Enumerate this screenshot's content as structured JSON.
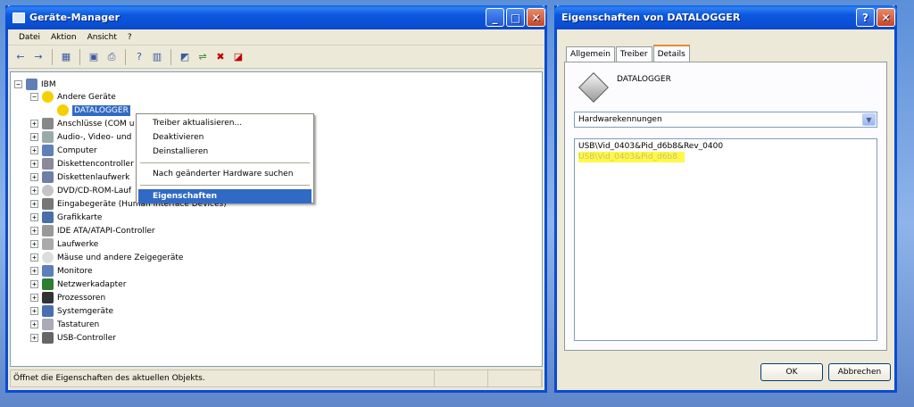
{
  "device_manager": {
    "title": "Geräte-Manager",
    "menu": [
      "Datei",
      "Aktion",
      "Ansicht",
      "?"
    ],
    "toolbar_icons": [
      "back-icon",
      "forward-icon",
      "view-icon",
      "properties-icon",
      "print-icon",
      "help-icon",
      "view2-icon",
      "scan-icon",
      "update-driver-icon",
      "disable-icon",
      "uninstall-icon"
    ],
    "tree": {
      "root": "IBM",
      "other_devices": "Andere Geräte",
      "datalogger": "DATALOGGER",
      "items": [
        "Anschlüsse (COM u",
        "Audio-, Video- und",
        "Computer",
        "Diskettencontroller",
        "Diskettenlaufwerk",
        "DVD/CD-ROM-Lauf",
        "Eingabegeräte (Human Interface Devices)",
        "Grafikkarte",
        "IDE ATA/ATAPI-Controller",
        "Laufwerke",
        "Mäuse und andere Zeigegeräte",
        "Monitore",
        "Netzwerkadapter",
        "Prozessoren",
        "Systemgeräte",
        "Tastaturen",
        "USB-Controller"
      ]
    },
    "status": "Öffnet die Eigenschaften des aktuellen Objekts."
  },
  "context_menu": {
    "update_driver": "Treiber aktualisieren...",
    "disable": "Deaktivieren",
    "uninstall": "Deinstallieren",
    "scan": "Nach geänderter Hardware suchen",
    "properties": "Eigenschaften"
  },
  "properties": {
    "title": "Eigenschaften von DATALOGGER",
    "tabs": [
      "Allgemein",
      "Treiber",
      "Details"
    ],
    "device_name": "DATALOGGER",
    "combo_value": "Hardwarekennungen",
    "ids": [
      "USB\\Vid_0403&Pid_d6b8&Rev_0400",
      "USB\\Vid_0403&Pid_d6b8"
    ],
    "ok": "OK",
    "cancel": "Abbrechen"
  }
}
